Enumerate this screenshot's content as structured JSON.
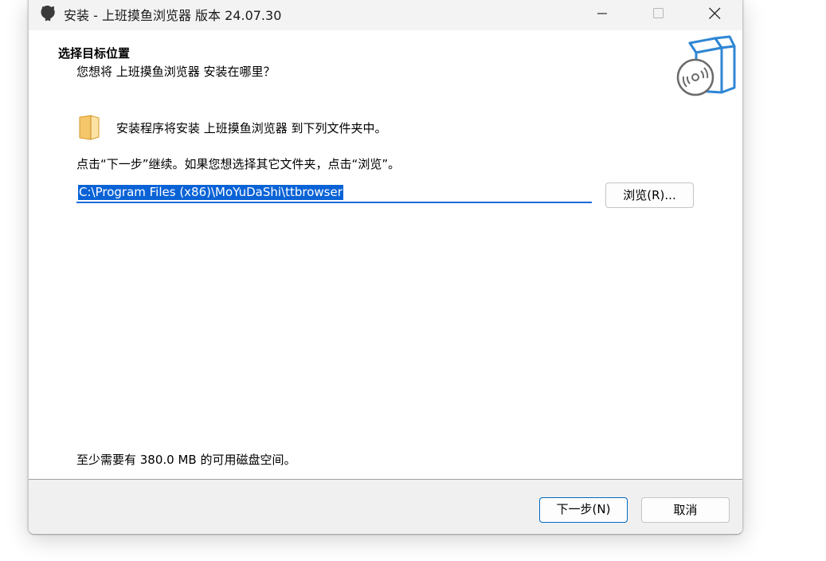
{
  "window": {
    "title": "安装 - 上班摸鱼浏览器 版本 24.07.30",
    "app_icon": "github-cat-icon",
    "controls": {
      "minimize_icon": "minimize-icon",
      "maximize_icon": "maximize-icon",
      "close_icon": "close-icon"
    }
  },
  "header": {
    "title": "选择目标位置",
    "subtitle": "您想将 上班摸鱼浏览器 安装在哪里？",
    "graphic": "software-box-disc-icon"
  },
  "content": {
    "folder_icon": "folder-icon",
    "info": "安装程序将安装 上班摸鱼浏览器 到下列文件夹中。",
    "instruction": "点击“下一步”继续。如果您想选择其它文件夹，点击“浏览”。",
    "install_path": "C:\\Program Files (x86)\\MoYuDaShi\\ttbrowser",
    "browse_label": "浏览(R)...",
    "disk_space": "至少需要有 380.0 MB 的可用磁盘空间。"
  },
  "footer": {
    "next_label": "下一步(N)",
    "cancel_label": "取消"
  },
  "colors": {
    "accent": "#0067c0",
    "selection": "#0a63d6",
    "titlebar": "#f3f3f3",
    "footer": "#f0f0f0"
  }
}
